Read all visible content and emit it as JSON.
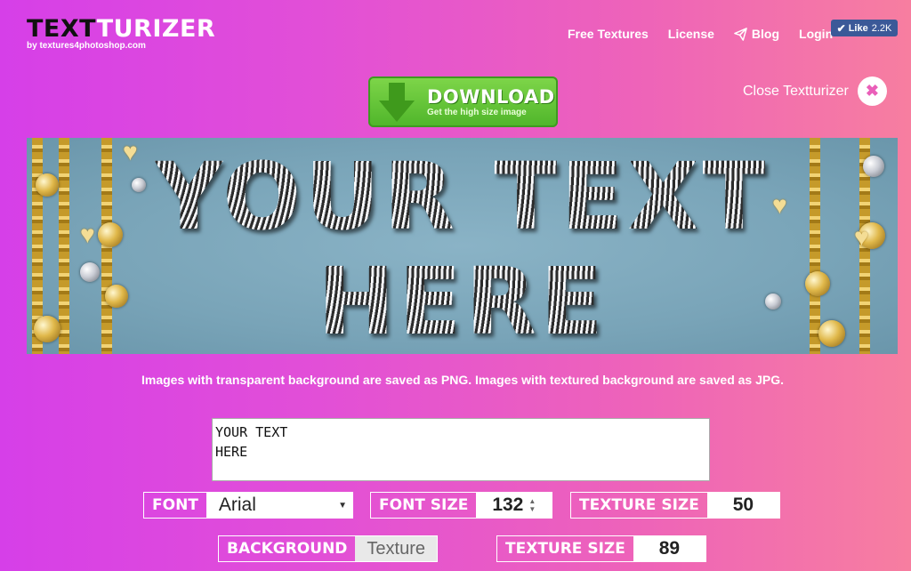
{
  "header": {
    "logo_dark": "TEXT",
    "logo_light": "TURIZER",
    "logo_sub": "by textures4photoshop.com",
    "nav": [
      {
        "label": "Free Textures"
      },
      {
        "label": "License"
      },
      {
        "label": "Blog",
        "icon": "paper-plane-icon"
      },
      {
        "label": "Login"
      }
    ],
    "like": {
      "label": "Like",
      "count": "2.2K",
      "color": "#3b5998"
    }
  },
  "download": {
    "title": "DOWNLOAD",
    "subtitle": "Get the high size image",
    "color": "#5cbf2a"
  },
  "close": {
    "label": "Close Textturizer",
    "icon": "close-icon"
  },
  "preview": {
    "line1": "YOUR TEXT",
    "line2": "HERE",
    "background_color": "#7fa9bc"
  },
  "notice": "Images with transparent background are saved as PNG. Images with textured background are saved as JPG.",
  "editor": {
    "text": "YOUR TEXT\nHERE"
  },
  "controls": {
    "font": {
      "label": "FONT",
      "value": "Arial"
    },
    "font_size": {
      "label": "FONT SIZE",
      "value": "132"
    },
    "texture_size_1": {
      "label": "TEXTURE SIZE",
      "value": "50"
    },
    "background": {
      "label": "BACKGROUND",
      "value": "Texture"
    },
    "texture_size_2": {
      "label": "TEXTURE SIZE",
      "value": "89"
    }
  }
}
